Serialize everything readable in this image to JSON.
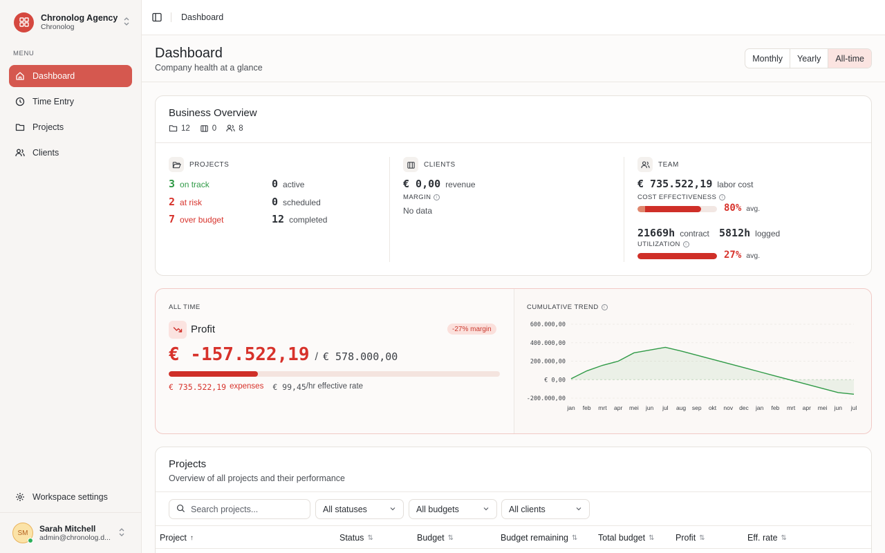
{
  "org": {
    "name": "Chronolog Agency",
    "sub": "Chronolog"
  },
  "sidebar": {
    "menu_label": "MENU",
    "items": [
      {
        "label": "Dashboard",
        "icon": "home-icon",
        "active": true
      },
      {
        "label": "Time Entry",
        "icon": "clock-icon",
        "active": false
      },
      {
        "label": "Projects",
        "icon": "folder-icon",
        "active": false
      },
      {
        "label": "Clients",
        "icon": "users-icon",
        "active": false
      }
    ],
    "workspace_settings": "Workspace settings"
  },
  "user": {
    "initials": "SM",
    "name": "Sarah Mitchell",
    "email": "admin@chronolog.d..."
  },
  "topbar": {
    "breadcrumb": "Dashboard"
  },
  "page": {
    "title": "Dashboard",
    "subtitle": "Company health at a glance",
    "periods": [
      "Monthly",
      "Yearly",
      "All-time"
    ],
    "active_period": "All-time"
  },
  "overview": {
    "title": "Business Overview",
    "counts": {
      "projects": "12",
      "clients": "0",
      "team": "8"
    },
    "projects": {
      "label": "PROJECTS",
      "on_track_n": "3",
      "on_track": "on track",
      "at_risk_n": "2",
      "at_risk": "at risk",
      "over_budget_n": "7",
      "over_budget": "over budget",
      "active_n": "0",
      "active": "active",
      "scheduled_n": "0",
      "scheduled": "scheduled",
      "completed_n": "12",
      "completed": "completed"
    },
    "clients": {
      "label": "CLIENTS",
      "revenue_value": "€ 0,00",
      "revenue": "revenue",
      "margin_label": "MARGIN",
      "margin_value": "No data"
    },
    "team": {
      "label": "TEAM",
      "labor_value": "€ 735.522,19",
      "labor": "labor cost",
      "cost_eff_label": "COST EFFECTIVENESS",
      "cost_eff_value": "80%",
      "cost_eff_pct": 80,
      "avg": "avg.",
      "contract_value": "21669h",
      "contract": "contract",
      "logged_value": "5812h",
      "logged": "logged",
      "util_label": "UTILIZATION",
      "util_value": "27%",
      "util_pct": 27
    }
  },
  "profit": {
    "period_label": "ALL TIME",
    "title": "Profit",
    "margin_badge": "-27% margin",
    "value": "€ -157.522,19",
    "slash": "/",
    "budget": "€ 578.000,00",
    "progress_pct": 27,
    "expenses_value": "€ 735.522,19",
    "expenses_label": "expenses",
    "rate_value": "€ 99,45",
    "rate_label": "/hr effective rate"
  },
  "chart_data": {
    "type": "area",
    "title": "CUMULATIVE TREND",
    "categories": [
      "jan",
      "feb",
      "mrt",
      "apr",
      "mei",
      "jun",
      "jul",
      "aug",
      "sep",
      "okt",
      "nov",
      "dec",
      "jan",
      "feb",
      "mrt",
      "apr",
      "mei",
      "jun",
      "jul"
    ],
    "series": [
      {
        "values": [
          10000,
          95000,
          155000,
          200000,
          290000,
          320000,
          350000,
          310000,
          265000,
          220000,
          175000,
          130000,
          85000,
          40000,
          -5000,
          -50000,
          -95000,
          -140000,
          -157522
        ]
      }
    ],
    "y_ticks": [
      "600.000,00",
      "400.000,00",
      "200.000,00",
      "€ 0,00",
      "-200.000,00"
    ],
    "ylim": [
      -200000,
      600000
    ],
    "grid": true,
    "line_color": "#2f9a46"
  },
  "projects_table": {
    "title": "Projects",
    "subtitle": "Overview of all projects and their performance",
    "search_placeholder": "Search projects...",
    "filters": [
      "All statuses",
      "All budgets",
      "All clients"
    ],
    "columns": [
      "Project",
      "Status",
      "Budget",
      "Budget remaining",
      "Total budget",
      "Profit",
      "Eff. rate"
    ]
  },
  "colors": {
    "accent": "#d5584f",
    "danger": "#d7322b",
    "success": "#2f9a46"
  }
}
